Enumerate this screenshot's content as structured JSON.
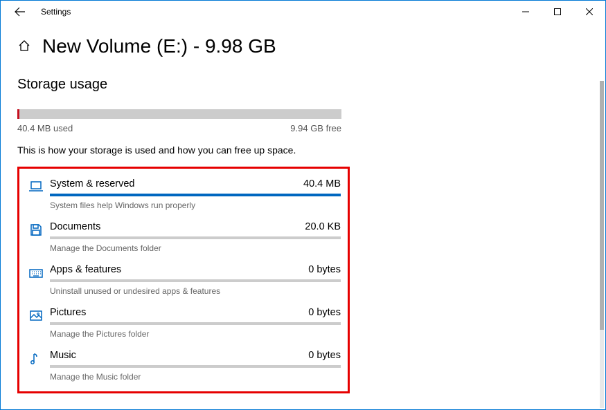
{
  "app_title": "Settings",
  "page_title": "New Volume (E:) - 9.98 GB",
  "section_heading": "Storage usage",
  "used_label": "40.4 MB used",
  "free_label": "9.94 GB free",
  "overall_fill_pct": 0.6,
  "description": "This is how your storage is used and how you can free up space.",
  "categories": [
    {
      "name": "System & reserved",
      "size": "40.4 MB",
      "hint": "System files help Windows run properly",
      "fill_pct": 100
    },
    {
      "name": "Documents",
      "size": "20.0 KB",
      "hint": "Manage the Documents folder",
      "fill_pct": 0
    },
    {
      "name": "Apps & features",
      "size": "0 bytes",
      "hint": "Uninstall unused or undesired apps & features",
      "fill_pct": 0
    },
    {
      "name": "Pictures",
      "size": "0 bytes",
      "hint": "Manage the Pictures folder",
      "fill_pct": 0
    },
    {
      "name": "Music",
      "size": "0 bytes",
      "hint": "Manage the Music folder",
      "fill_pct": 0
    }
  ]
}
